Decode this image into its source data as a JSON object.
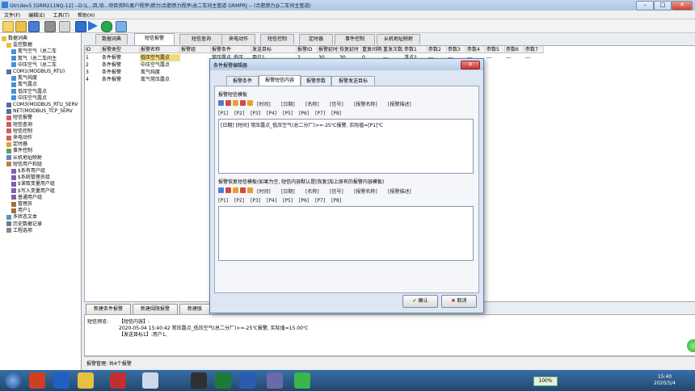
{
  "window": {
    "title": "Gtrcdev5 [GRM211NQ-12] --D:\\L...目,珀...项目资料\\客户程序\\燃力\\合肥燃力程序\\总二车间主管道 GRMPRJ -- (合肥燃力@二车间主管道)",
    "min": "–",
    "max": "□",
    "close": "✕"
  },
  "menu": [
    "文件(F)",
    "编辑(E)",
    "工具(T)",
    "帮助(H)"
  ],
  "tree": [
    {
      "label": "数据词典",
      "icon": "folder-icon"
    },
    {
      "label": "监控数据",
      "icon": "folder-icon"
    },
    {
      "label": "氮气空气（总二车",
      "icon": "tag-icon"
    },
    {
      "label": "氮气（总二车间主",
      "icon": "tag-icon"
    },
    {
      "label": "中压空气（总二车",
      "icon": "tag-icon"
    },
    {
      "label": "COM1(MODBUS_RTU)",
      "icon": "port-icon"
    },
    {
      "label": "氮气纯度",
      "icon": "tag-icon"
    },
    {
      "label": "氮气露点",
      "icon": "tag-icon"
    },
    {
      "label": "低压空气露点",
      "icon": "tag-icon"
    },
    {
      "label": "中压空气露点",
      "icon": "tag-icon"
    },
    {
      "label": "COM3(MODBUS_RTU_SERV",
      "icon": "port-icon"
    },
    {
      "label": "NET(MODBUS_TCP_SERV",
      "icon": "port-icon"
    },
    {
      "label": "短信报警",
      "icon": "alarm-icon"
    },
    {
      "label": "短信查询",
      "icon": "alarm-icon"
    },
    {
      "label": "短信控制",
      "icon": "alarm-icon"
    },
    {
      "label": "来电动作",
      "icon": "alarm-icon"
    },
    {
      "label": "定时器",
      "icon": "clock-icon"
    },
    {
      "label": "事件控制",
      "icon": "event-icon"
    },
    {
      "label": "从机地址映射",
      "icon": "map-icon"
    },
    {
      "label": "短信用户和组",
      "icon": "users-icon"
    },
    {
      "label": "$系有用户组",
      "icon": "group-icon"
    },
    {
      "label": "$系统管理员组",
      "icon": "group-icon"
    },
    {
      "label": "$读取变量用户组",
      "icon": "group-icon"
    },
    {
      "label": "$写入变量用户组",
      "icon": "group-icon"
    },
    {
      "label": "普通用户组",
      "icon": "group-icon"
    },
    {
      "label": "管理员",
      "icon": "user-icon"
    },
    {
      "label": "用户1",
      "icon": "user-icon"
    },
    {
      "label": "多状态文本",
      "icon": "text-icon"
    },
    {
      "label": "历史数据记录",
      "icon": "history-icon"
    },
    {
      "label": "工程选项",
      "icon": "options-icon"
    }
  ],
  "tabs": [
    "数据词典",
    "短信报警",
    "短信查询",
    "来电动作",
    "短信控制",
    "定时器",
    "事件控制",
    "从机地址映射"
  ],
  "grid": {
    "headers": [
      "ID",
      "报警类型",
      "报警名称",
      "报警组",
      "报警条件",
      "发送目标",
      "报警ID",
      "报警延时",
      "恢复延时",
      "重复间隔",
      "重发次数",
      "参数1",
      "参数2",
      "参数3",
      "参数4",
      "参数5",
      "参数6",
      "参数7"
    ],
    "rows": [
      [
        "1",
        "条件报警",
        "低压空气露点",
        "",
        "常压露点_低压",
        "用户1",
        "2",
        "30",
        "30",
        "0",
        "---",
        "浮点2",
        "---",
        "---",
        "---",
        "---",
        "---",
        "---"
      ],
      [
        "2",
        "条件报警",
        "中压空气露点",
        "",
        "",
        "",
        "",
        "",
        "",
        "",
        "",
        "",
        "",
        "",
        "",
        "",
        "",
        ""
      ],
      [
        "3",
        "条件报警",
        "氮气纯度",
        "",
        "",
        "",
        "",
        "",
        "",
        "",
        "",
        "",
        "",
        "",
        "",
        "",
        "",
        ""
      ],
      [
        "4",
        "条件报警",
        "氮气常压露点",
        "",
        "",
        "",
        "",
        "",
        "",
        "",
        "",
        "",
        "",
        "",
        "",
        "",
        "",
        ""
      ]
    ]
  },
  "buttons": {
    "new_condition": "新建条件报警",
    "new_threshold": "新建阈限报警",
    "new_state": "新建版"
  },
  "preview": {
    "label": "短信预览:",
    "line1": "【短信内容】:",
    "line2": "2020-05-04 15:40:42 常压露点_低压空气(总二分厂)>=-25℃报警, 实际值=15.00℃",
    "line3": "【发送目标1】:用户1,"
  },
  "status": "报警管理: 共4个报警",
  "dialog": {
    "title": "条件报警编辑器",
    "tabs": [
      "报警条件",
      "报警短信内容",
      "报警参数",
      "报警发送目标"
    ],
    "section1": "报警短信模板",
    "section2": "报警恢复短信模板(如果为空, 短信内容默认是[恢复]加上原有的报警内容模板)",
    "fields": [
      "[时间]",
      "[日期]",
      "[名称]",
      "[信号]",
      "[报警名称]",
      "[报警描述]"
    ],
    "params": [
      "[P1]",
      "[P2]",
      "[P3]",
      "[P4]",
      "[P5]",
      "[P6]",
      "[P7]",
      "[P8]"
    ],
    "template": "[日期] [时间] 常压露点_低压空气(总二分厂)>=-25℃报警, 实际值=[P1]℃",
    "ok": "确认",
    "cancel": "取消"
  },
  "taskbar": {
    "battery": "100%",
    "time": "15:40",
    "date": "2020/5/4"
  },
  "colors": {
    "accent": "#3a7bd5",
    "taskbar": "#20486f",
    "dialog": "#dde6f2"
  }
}
